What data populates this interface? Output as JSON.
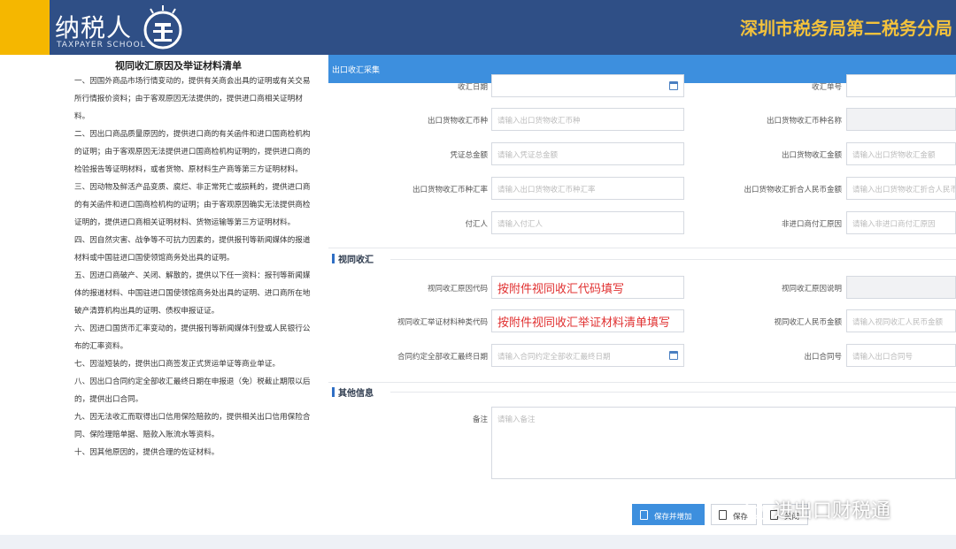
{
  "header": {
    "logo_text": "纳税人",
    "logo_sub": "TAXPAYER SCHOOL",
    "bureau": "深圳市税务局第二税务分局",
    "brand_color": "#f5b700",
    "bar_color": "#2f4f86"
  },
  "document": {
    "title": "视同收汇原因及举证材料清单",
    "paragraphs": [
      "一、因国外商品市场行情变动的，提供有关商会出具的证明或有关交易所行情报价资料；由于客观原因无法提供的，提供进口商相关证明材料。",
      "二、因出口商品质量原因的，提供进口商的有关函件和进口国商检机构的证明；由于客观原因无法提供进口国商检机构证明的，提供进口商的检验报告等证明材料，或者货物、原材料生产商等第三方证明材料。",
      "三、因动物及鲜活产品变质、腐烂、非正常死亡或损耗的，提供进口商的有关函件和进口国商检机构的证明；由于客观原因确实无法提供商检证明的，提供进口商相关证明材料、货物运输等第三方证明材料。",
      "四、因自然灾害、战争等不可抗力因素的，提供报刊等新闻媒体的报道材料或中国驻进口国使领馆商务处出具的证明。",
      "五、因进口商破产、关闭、解散的，提供以下任一资料：报刊等新闻媒体的报道材料、中国驻进口国使领馆商务处出具的证明、进口商所在地破产清算机构出具的证明、债权申报证证。",
      "六、因进口国货币汇率变动的，提供报刊等新闻媒体刊登或人民银行公布的汇率资料。",
      "七、因溢短装的，提供出口商签发正式货运单证等商业单证。",
      "八、因出口合同约定全部收汇最终日期在申报退（免）税截止期限以后的，提供出口合同。",
      "九、因无法收汇而取得出口信用保险赔款的，提供相关出口信用保险合同、保险理赔单据、赔款入账流水等资料。",
      "十、因其他原因的，提供合理的佐证材料。"
    ]
  },
  "form": {
    "bar_title": "出口收汇采集",
    "rows": [
      {
        "l_label": "收汇日期",
        "l_placeholder": "",
        "r_label": "收汇单号",
        "r_placeholder": ""
      },
      {
        "l_label": "出口货物收汇币种",
        "l_placeholder": "请输入出口货物收汇币种",
        "r_label": "出口货物收汇币种名称",
        "r_placeholder": ""
      },
      {
        "l_label": "凭证总金额",
        "l_placeholder": "请输入凭证总金额",
        "r_label": "出口货物收汇金额",
        "r_placeholder": "请输入出口货物收汇金额"
      },
      {
        "l_label": "出口货物收汇币种汇率",
        "l_placeholder": "请输入出口货物收汇币种汇率",
        "r_label": "出口货物收汇折合人民币金额",
        "r_placeholder": "请输入出口货物收汇折合人民币"
      },
      {
        "l_label": "付汇人",
        "l_placeholder": "请输入付汇人",
        "r_label": "非进口商付汇原因",
        "r_placeholder": "请输入非进口商付汇原因"
      }
    ],
    "section_shoushou": "视同收汇",
    "rows2": [
      {
        "l_label": "视同收汇原因代码",
        "l_hint": "按附件视同收汇代码填写",
        "r_label": "视同收汇原因说明",
        "r_placeholder": ""
      },
      {
        "l_label": "视同收汇举证材料种类代码",
        "l_hint": "按附件视同收汇举证材料清单填写",
        "r_label": "视同收汇人民币金额",
        "r_placeholder": "请输入视同收汇人民币金额"
      },
      {
        "l_label": "合同约定全部收汇最终日期",
        "l_placeholder": "请输入合同约定全部收汇最终日期",
        "r_label": "出口合同号",
        "r_placeholder": "请输入出口合同号"
      }
    ],
    "section_other": "其他信息",
    "remark_label": "备注",
    "remark_placeholder": "请输入备注",
    "btn_save_add": "保存并增加",
    "btn_save": "保存",
    "btn_close": "关闭",
    "accent_color": "#3d8fde",
    "hint_color": "#e03030"
  },
  "watermark": "进出口财税通"
}
